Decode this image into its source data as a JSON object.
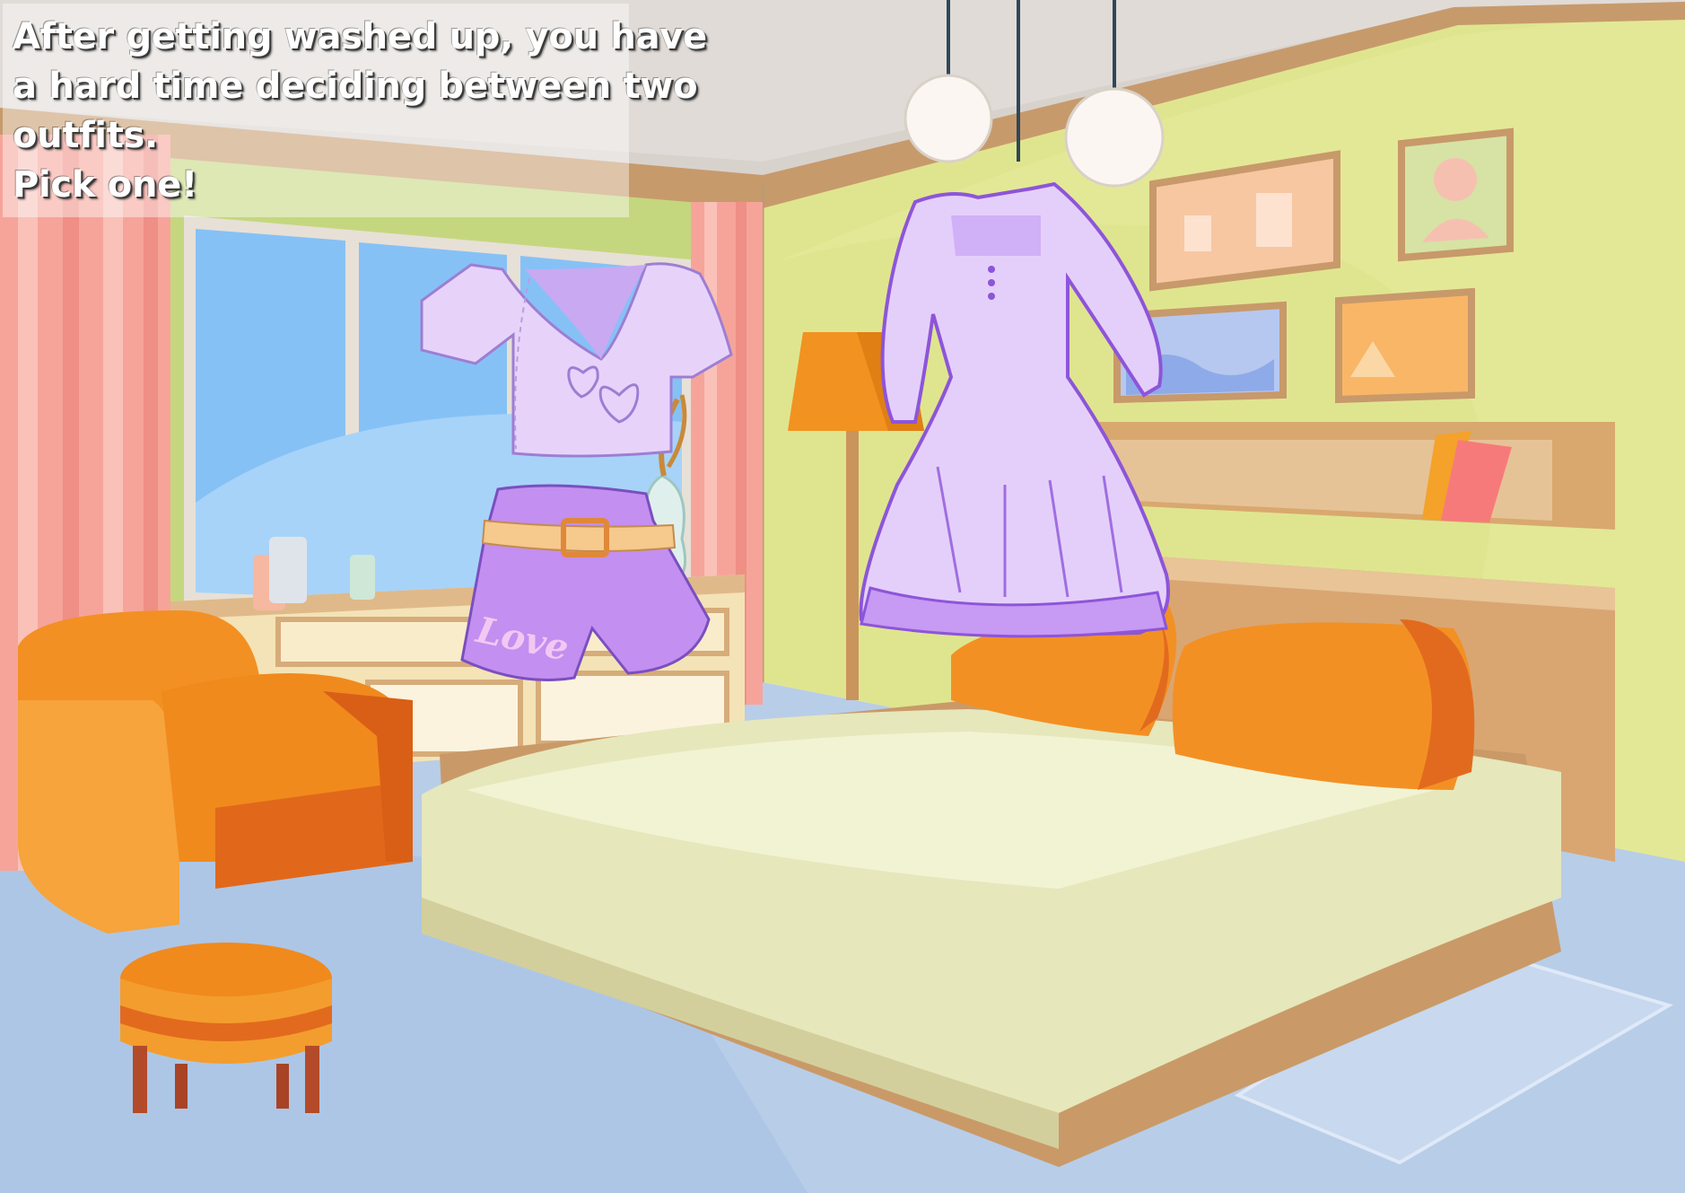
{
  "prompt": {
    "line1": "After getting washed up, you have",
    "line2": "a hard time deciding between two",
    "line3": "outfits.",
    "line4": "Pick one!"
  },
  "outfits": [
    {
      "id": "outfit-crop-top-and-shorts",
      "shorts_lettering": "Love"
    },
    {
      "id": "outfit-lavender-dress"
    }
  ],
  "colors": {
    "wall": "#dfe68f",
    "ceiling": "#d9d3cf",
    "floor": "#9fbde3",
    "curtain": "#f7a49a",
    "window_glass": "#8cc4f8",
    "sofa_orange": "#f28a1e",
    "bed_sheet": "#eef0c4",
    "outfit_lavender": "#e2cdf7",
    "outfit_purple": "#c78ff0"
  }
}
